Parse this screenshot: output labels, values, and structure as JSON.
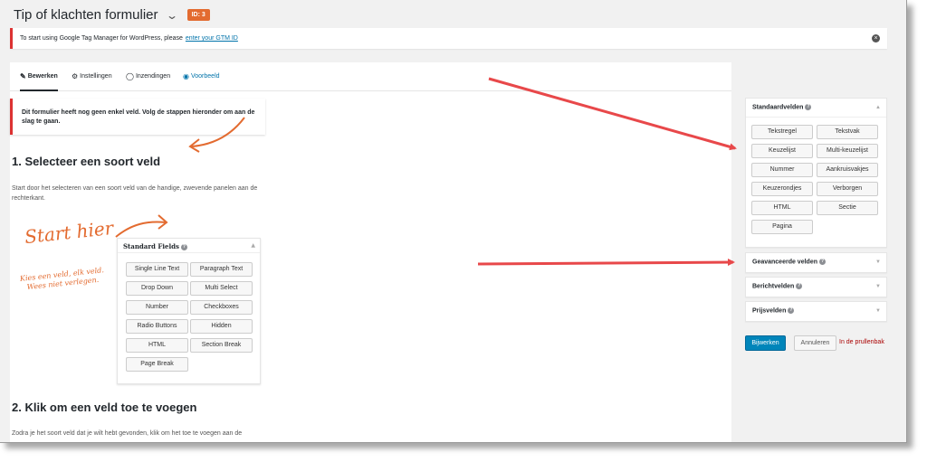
{
  "header": {
    "title": "Tip of klachten formulier",
    "id_badge": "ID: 3"
  },
  "notice": {
    "text": "To start using Google Tag Manager for WordPress, please",
    "link": "enter your GTM ID"
  },
  "tabs": [
    {
      "label": "Bewerken",
      "icon": "pencil-edit-icon"
    },
    {
      "label": "Instellingen",
      "icon": "gears-icon"
    },
    {
      "label": "Inzendingen",
      "icon": "speech-bubble-icon"
    },
    {
      "label": "Voorbeeld",
      "icon": "eye-icon"
    }
  ],
  "warning": {
    "text": "Dit formulier heeft nog geen enkel veld. Volg de stappen hieronder om aan de slag te gaan."
  },
  "step1": {
    "heading": "1. Selecteer een soort veld",
    "text": "Start door het selecteren van een soort veld van de handige, zwevende panelen aan de rechterkant."
  },
  "annotation": {
    "start_here": "Start hier",
    "note": "Kies een veld, elk veld. Wees niet verlegen."
  },
  "standard_panel": {
    "title": "Standard Fields",
    "buttons": [
      "Single Line Text",
      "Paragraph Text",
      "Drop Down",
      "Multi Select",
      "Number",
      "Checkboxes",
      "Radio Buttons",
      "Hidden",
      "HTML",
      "Section Break",
      "Page Break"
    ]
  },
  "step2": {
    "heading": "2. Klik om een veld toe te voegen",
    "text": "Zodra je het soort veld dat je wilt hebt gevonden, klik om het toe te voegen aan de"
  },
  "sidebar": {
    "standard": {
      "title": "Standaardvelden",
      "buttons": [
        "Tekstregel",
        "Tekstvak",
        "Keuzelijst",
        "Multi-keuzelijst",
        "Nummer",
        "Aankruisvakjes",
        "Keuzerondjes",
        "Verborgen",
        "HTML",
        "Sectie",
        "Pagina"
      ]
    },
    "advanced": {
      "title": "Geavanceerde velden"
    },
    "post": {
      "title": "Berichtvelden"
    },
    "pricing": {
      "title": "Prijsvelden"
    }
  },
  "actions": {
    "update": "Bijwerken",
    "cancel": "Annuleren",
    "trash": "In de prullenbak"
  },
  "colors": {
    "accent_orange": "#e36b30",
    "arrow_red": "#e8484a",
    "link_blue": "#0073aa",
    "primary_button": "#0085ba",
    "error_red": "#dc3232"
  }
}
